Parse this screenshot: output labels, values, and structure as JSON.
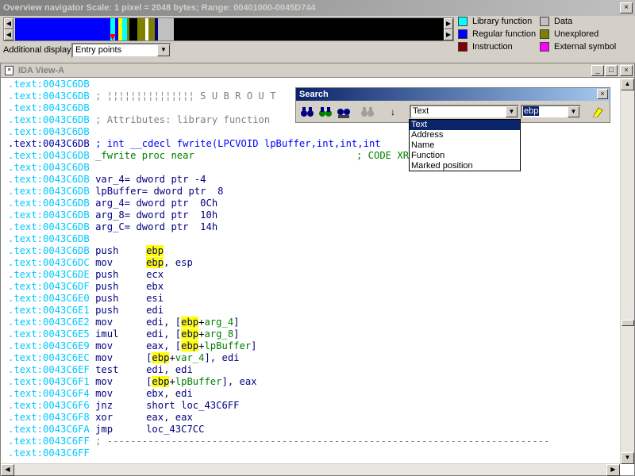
{
  "overview": {
    "title": "Overview navigator Scale: 1 pixel = 2048 bytes; Range: 00401000-0045D744",
    "additional_display_label": "Additional display:",
    "additional_display_value": "Entry points",
    "legend": [
      {
        "label": "Library function",
        "color": "#00ffff"
      },
      {
        "label": "Data",
        "color": "#c0c0c0"
      },
      {
        "label": "Regular function",
        "color": "#0000ff"
      },
      {
        "label": "Unexplored",
        "color": "#808000"
      },
      {
        "label": "Instruction",
        "color": "#800000"
      },
      {
        "label": "External symbol",
        "color": "#ff00ff"
      }
    ]
  },
  "ida_view": {
    "title": "IDA View-A",
    "lines": [
      {
        "addr": ".text:0043C6DB",
        "rest": ""
      },
      {
        "addr": ".text:0043C6DB",
        "rest": "; ¦¦¦¦¦¦¦¦¦¦¦¦¦¦¦ S U B R O U T"
      },
      {
        "addr": ".text:0043C6DB",
        "rest": ""
      },
      {
        "addr": ".text:0043C6DB",
        "rest": "; Attributes: library function"
      },
      {
        "addr": ".text:0043C6DB",
        "rest": ""
      },
      {
        "addr": ".text:0043C6DB",
        "rest": "; int __cdecl fwrite(LPCVOID lpBuffer,int,int,int"
      },
      {
        "addr": ".text:0043C6DB",
        "rest": "_fwrite proc near",
        "tail": "; CODE XR"
      },
      {
        "addr": ".text:0043C6DB",
        "rest": ""
      },
      {
        "addr": ".text:0043C6DB",
        "rest": "var_4= dword ptr -4"
      },
      {
        "addr": ".text:0043C6DB",
        "rest": "lpBuffer= dword ptr  8"
      },
      {
        "addr": ".text:0043C6DB",
        "rest": "arg_4= dword ptr  0Ch"
      },
      {
        "addr": ".text:0043C6DB",
        "rest": "arg_8= dword ptr  10h"
      },
      {
        "addr": ".text:0043C6DB",
        "rest": "arg_C= dword ptr  14h"
      },
      {
        "addr": ".text:0043C6DB",
        "rest": ""
      },
      {
        "addr": ".text:0043C6DB",
        "mn": "push",
        "a": "",
        "hl": "ebp",
        "b": ""
      },
      {
        "addr": ".text:0043C6DC",
        "mn": "mov",
        "a": "",
        "hl": "ebp",
        "b": ", esp"
      },
      {
        "addr": ".text:0043C6DE",
        "mn": "push",
        "a": "ecx",
        "hl": "",
        "b": ""
      },
      {
        "addr": ".text:0043C6DF",
        "mn": "push",
        "a": "ebx",
        "hl": "",
        "b": ""
      },
      {
        "addr": ".text:0043C6E0",
        "mn": "push",
        "a": "esi",
        "hl": "",
        "b": ""
      },
      {
        "addr": ".text:0043C6E1",
        "mn": "push",
        "a": "edi",
        "hl": "",
        "b": ""
      },
      {
        "addr": ".text:0043C6E2",
        "mn": "mov",
        "a": "edi, [",
        "hl": "ebp",
        "b": "+arg_4]"
      },
      {
        "addr": ".text:0043C6E5",
        "mn": "imul",
        "a": "edi, [",
        "hl": "ebp",
        "b": "+arg_8]"
      },
      {
        "addr": ".text:0043C6E9",
        "mn": "mov",
        "a": "eax, [",
        "hl": "ebp",
        "b": "+lpBuffer]"
      },
      {
        "addr": ".text:0043C6EC",
        "mn": "mov",
        "a": "[",
        "hl": "ebp",
        "b": "+var_4], edi"
      },
      {
        "addr": ".text:0043C6EF",
        "mn": "test",
        "a": "edi, edi",
        "hl": "",
        "b": ""
      },
      {
        "addr": ".text:0043C6F1",
        "mn": "mov",
        "a": "[",
        "hl": "ebp",
        "b": "+lpBuffer], eax"
      },
      {
        "addr": ".text:0043C6F4",
        "mn": "mov",
        "a": "ebx, edi",
        "hl": "",
        "b": ""
      },
      {
        "addr": ".text:0043C6F6",
        "mn": "jnz",
        "a": "short loc_43C6FF",
        "hl": "",
        "b": ""
      },
      {
        "addr": ".text:0043C6F8",
        "mn": "xor",
        "a": "eax, eax",
        "hl": "",
        "b": ""
      },
      {
        "addr": ".text:0043C6FA",
        "mn": "jmp",
        "a": "loc_43C7CC",
        "hl": "",
        "b": ""
      },
      {
        "addr": ".text:0043C6FF",
        "rest": "; ----------------------------------------------------------------------------"
      },
      {
        "addr": ".text:0043C6FF",
        "rest": ""
      }
    ]
  },
  "search": {
    "title": "Search",
    "type_value": "Text",
    "search_value": "ebp",
    "options": [
      "Text",
      "Address",
      "Name",
      "Function",
      "Marked position"
    ]
  }
}
